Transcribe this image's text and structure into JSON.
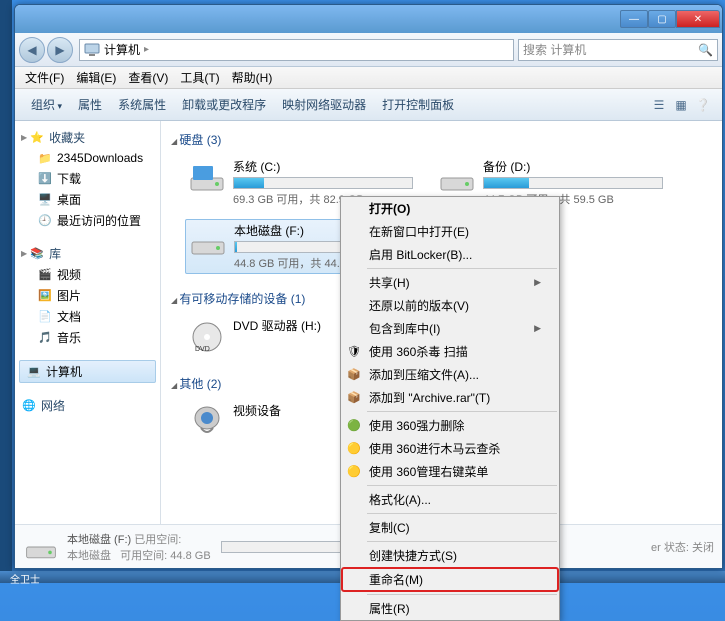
{
  "window": {
    "address_label": "计算机",
    "address_arrow": "▸",
    "search_placeholder": "搜索 计算机",
    "min": "—",
    "max": "▢",
    "close": "✕"
  },
  "menubar": [
    "文件(F)",
    "编辑(E)",
    "查看(V)",
    "工具(T)",
    "帮助(H)"
  ],
  "toolbar": {
    "organize": "组织",
    "properties": "属性",
    "sysprops": "系统属性",
    "uninstall": "卸载或更改程序",
    "mapnet": "映射网络驱动器",
    "controlpanel": "打开控制面板"
  },
  "sidebar": {
    "favorites": {
      "label": "收藏夹",
      "items": [
        "2345Downloads",
        "下载",
        "桌面",
        "最近访问的位置"
      ]
    },
    "libraries": {
      "label": "库",
      "items": [
        "视频",
        "图片",
        "文档",
        "音乐"
      ]
    },
    "computer": {
      "label": "计算机"
    },
    "network": {
      "label": "网络"
    }
  },
  "sections": {
    "drives": "硬盘 (3)",
    "removable": "有可移动存储的设备 (1)",
    "other": "其他 (2)"
  },
  "drives": [
    {
      "name": "系统 (C:)",
      "stat": "69.3 GB 可用，共 82.9 GB",
      "pct": 17
    },
    {
      "name": "备份 (D:)",
      "stat": "44.7 GB 可用，共 59.5 GB",
      "pct": 25
    },
    {
      "name": "本地磁盘 (F:)",
      "stat": "44.8 GB 可用，共 44.9 GB",
      "pct": 1
    }
  ],
  "removable": [
    {
      "name": "DVD 驱动器 (H:)"
    }
  ],
  "other": [
    {
      "name": "视频设备"
    }
  ],
  "statusbar": {
    "title": "本地磁盘 (F:)",
    "used_label": "已用空间:",
    "sub": "本地磁盘",
    "free_label": "可用空间:",
    "free_val": "44.8 GB",
    "right": "er 状态: 关闭"
  },
  "context": [
    {
      "t": "打开(O)",
      "bold": true
    },
    {
      "t": "在新窗口中打开(E)"
    },
    {
      "t": "启用 BitLocker(B)..."
    },
    {
      "sep": true
    },
    {
      "t": "共享(H)",
      "sub": true
    },
    {
      "t": "还原以前的版本(V)"
    },
    {
      "t": "包含到库中(I)",
      "sub": true
    },
    {
      "t": "使用 360杀毒 扫描",
      "ic": "🛡"
    },
    {
      "t": "添加到压缩文件(A)...",
      "ic": "📦"
    },
    {
      "t": "添加到 \"Archive.rar\"(T)",
      "ic": "📦"
    },
    {
      "sep": true
    },
    {
      "t": "使用 360强力删除",
      "ic": "🟢"
    },
    {
      "t": "使用 360进行木马云查杀",
      "ic": "🟡"
    },
    {
      "t": "使用 360管理右键菜单",
      "ic": "🟡"
    },
    {
      "sep": true
    },
    {
      "t": "格式化(A)..."
    },
    {
      "sep": true
    },
    {
      "t": "复制(C)"
    },
    {
      "sep": true
    },
    {
      "t": "创建快捷方式(S)"
    },
    {
      "t": "重命名(M)",
      "hl": true
    },
    {
      "sep": true
    },
    {
      "t": "属性(R)"
    }
  ],
  "taskbar": "全卫士"
}
